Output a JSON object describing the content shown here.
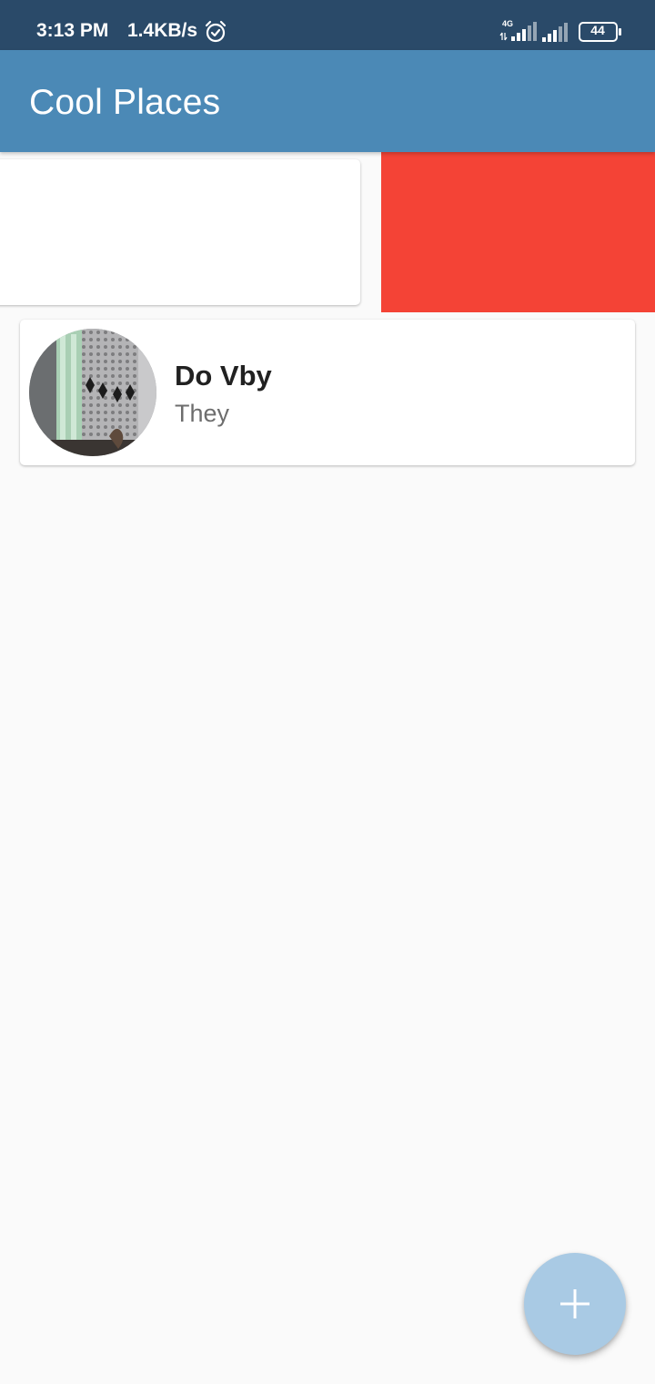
{
  "status_bar": {
    "time": "3:13 PM",
    "network_speed": "1.4KB/s",
    "network_type": "4G",
    "battery": "44"
  },
  "app_bar": {
    "title": "Cool Places"
  },
  "places": [
    {
      "title": "",
      "subtitle": "",
      "swiped": true
    },
    {
      "title": "Do Vby",
      "subtitle": "They",
      "swiped": false
    }
  ],
  "actions": {
    "swipe_action_icon": "trash-icon",
    "fab_icon": "plus-icon"
  },
  "colors": {
    "status_bar": "#2a4a69",
    "app_bar": "#4b89b6",
    "delete_bg": "#f44336",
    "fab": "#a9cae4",
    "background": "#fafafa"
  }
}
